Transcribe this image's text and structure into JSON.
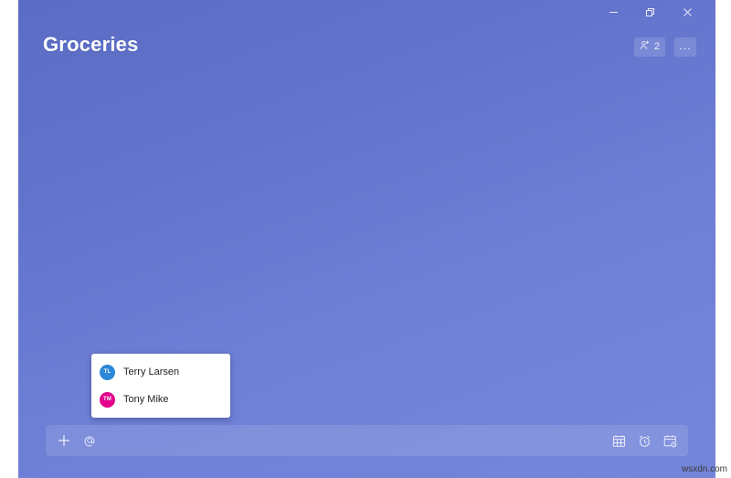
{
  "window": {
    "title": "Groceries",
    "controls": {
      "minimize": {
        "name": "minimize-button",
        "label": "Minimize"
      },
      "maximize": {
        "name": "maximize-button",
        "label": "Restore Down"
      },
      "close": {
        "name": "close-button",
        "label": "Close"
      }
    }
  },
  "header": {
    "title": "Groceries",
    "share": {
      "icon": "people-add-icon",
      "count": "2",
      "label": "Shared with 2 people"
    },
    "more": {
      "icon": "ellipsis-icon",
      "label": "..."
    }
  },
  "mention_popup": {
    "visible": true,
    "people": [
      {
        "initials": "TL",
        "name": "Terry Larsen",
        "color": "#2b88d8"
      },
      {
        "initials": "TM",
        "name": "Tony Mike",
        "color": "#e3008c"
      }
    ]
  },
  "add_task_bar": {
    "add_icon": "plus-icon",
    "mention_icon": "at-mention-icon",
    "input_value": "",
    "input_placeholder": "",
    "tools": [
      {
        "icon": "calendar-icon",
        "label": "Add due date"
      },
      {
        "icon": "alarm-clock-icon",
        "label": "Remind me"
      },
      {
        "icon": "repeat-calendar-icon",
        "label": "Repeat"
      }
    ]
  },
  "watermark": {
    "text": "wsxdn.com"
  },
  "colors": {
    "accent_start": "#5a6cc4",
    "accent_end": "#7586da",
    "avatar_blue": "#2b88d8",
    "avatar_pink": "#e3008c",
    "popup_bg": "#ffffff",
    "text_on_accent": "#ffffff"
  }
}
